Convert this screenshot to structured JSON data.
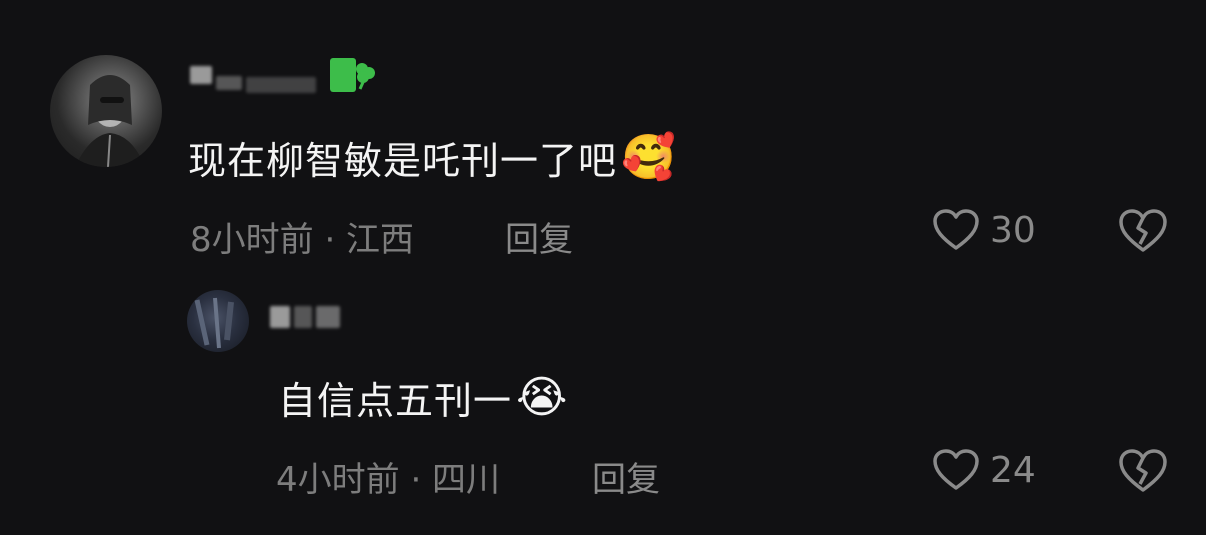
{
  "comments": [
    {
      "text": "现在柳智敏是吒刊一了吧",
      "emoji": "🥰",
      "meta": "8小时前 · 江西",
      "reply_label": "回复",
      "likes": "30",
      "badge_color": "#3dbd4a"
    }
  ],
  "reply": {
    "text": "自信点五刊一",
    "emoji": "😭",
    "meta": "4小时前 · 四川",
    "reply_label": "回复",
    "likes": "24"
  },
  "icons": {
    "like": "heart-outline-icon",
    "dislike": "broken-heart-icon"
  },
  "colors": {
    "background": "#111113",
    "text": "#f4f4f4",
    "meta": "#7d7d7d",
    "badge": "#3dbd4a"
  }
}
